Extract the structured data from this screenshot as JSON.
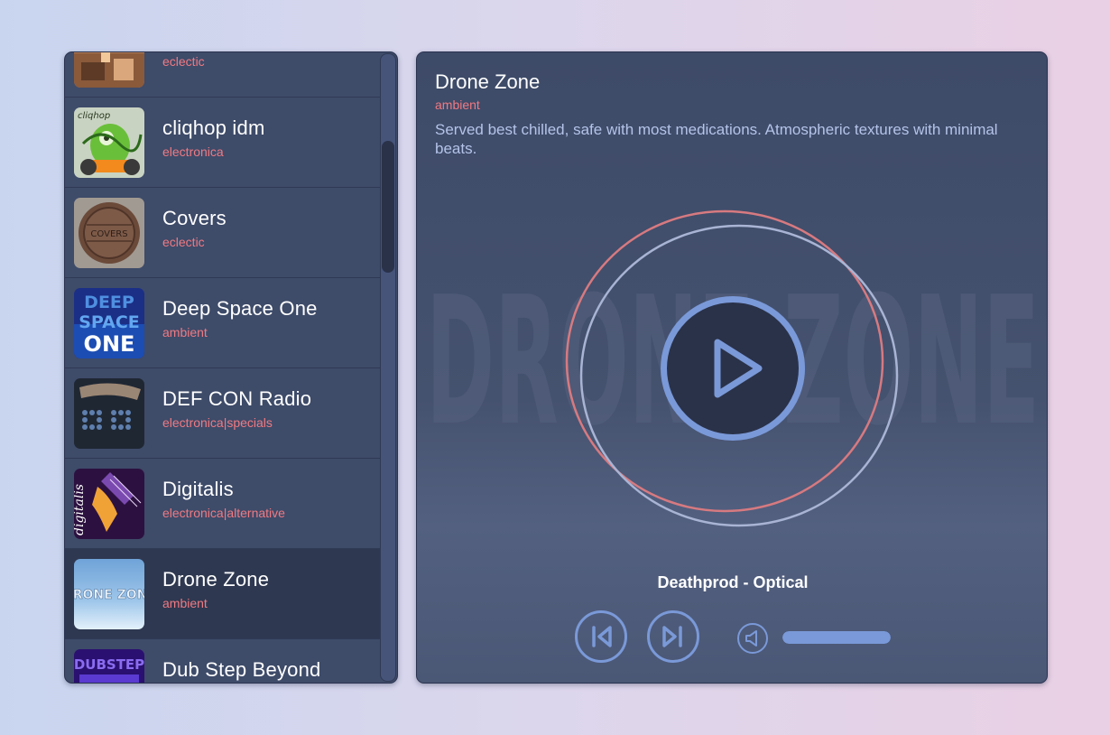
{
  "stations": [
    {
      "name": "",
      "genre": "eclectic",
      "art": "eclectic-art-icon"
    },
    {
      "name": "cliqhop idm",
      "genre": "electronica",
      "art": "cliqhop-art-icon"
    },
    {
      "name": "Covers",
      "genre": "eclectic",
      "art": "covers-art-icon"
    },
    {
      "name": "Deep Space One",
      "genre": "ambient",
      "art": "deep-space-one-art-icon"
    },
    {
      "name": "DEF CON Radio",
      "genre": "electronica|specials",
      "art": "defcon-art-icon"
    },
    {
      "name": "Digitalis",
      "genre": "electronica|alternative",
      "art": "digitalis-art-icon"
    },
    {
      "name": "Drone Zone",
      "genre": "ambient",
      "art": "drone-zone-art-icon",
      "active": true
    },
    {
      "name": "Dub Step Beyond",
      "genre": "",
      "art": "dubstep-art-icon"
    }
  ],
  "art_text": {
    "cliqhop": "cliqhop",
    "covers": "COVERS",
    "deep_space_1": "DEEP",
    "deep_space_2": "SPACE",
    "deep_space_3": "ONE",
    "digitalis": "digitalis",
    "drone_zone": "DRONE ZONE",
    "dubstep": "DUBSTEP"
  },
  "player": {
    "title": "Drone Zone",
    "genre": "ambient",
    "description": "Served best chilled, safe with most medications. Atmospheric textures with minimal beats.",
    "background_text": "DRONE ZONE",
    "track": "Deathprod - Optical",
    "volume": 1.0
  },
  "colors": {
    "panel": "#3e4b69",
    "accent": "#7a99d8",
    "genre": "#f07a82",
    "ring_outer": "#d77a80",
    "ring_inner": "#a9b4d4"
  }
}
